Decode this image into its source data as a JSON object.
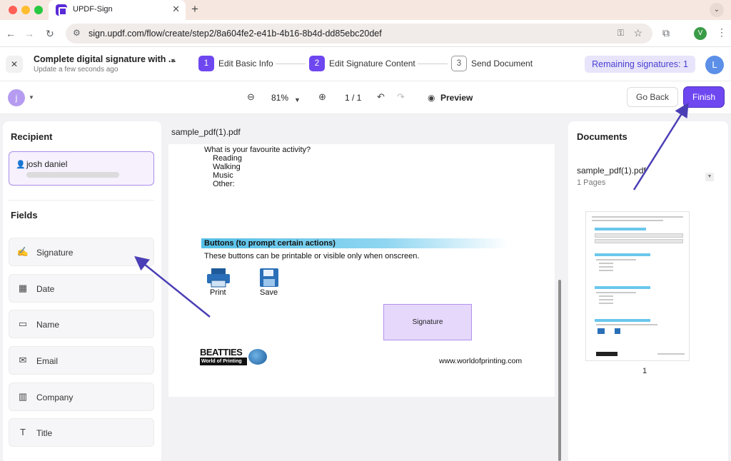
{
  "browser": {
    "tab_title": "UPDF-Sign",
    "tab_close": "✕",
    "new_tab": "+",
    "url": "sign.updf.com/flow/create/step2/8a604fe2-e41b-4b16-8b4d-dd85ebc20def",
    "profile_initial": "V"
  },
  "header": {
    "title": "Complete digital signature with ...",
    "subtitle": "Update a few seconds ago",
    "steps": [
      {
        "num": "1",
        "label": "Edit Basic Info"
      },
      {
        "num": "2",
        "label": "Edit Signature Content"
      },
      {
        "num": "3",
        "label": "Send Document"
      }
    ],
    "remaining": "Remaining signatures: 1",
    "avatar": "L"
  },
  "toolbar": {
    "user_initial": "j",
    "zoom": "81%",
    "page": "1 / 1",
    "preview": "Preview",
    "go_back": "Go Back",
    "finish": "Finish"
  },
  "left": {
    "recipient_heading": "Recipient",
    "recipient_name": "josh daniel",
    "recipient_email": "",
    "fields_heading": "Fields",
    "fields": [
      {
        "label": "Signature",
        "icon": "signature-icon"
      },
      {
        "label": "Date",
        "icon": "calendar-icon"
      },
      {
        "label": "Name",
        "icon": "id-card-icon"
      },
      {
        "label": "Email",
        "icon": "envelope-icon"
      },
      {
        "label": "Company",
        "icon": "building-icon"
      },
      {
        "label": "Title",
        "icon": "title-icon"
      }
    ]
  },
  "pdf": {
    "filename": "sample_pdf(1).pdf",
    "question": "What is your favourite activity?",
    "options": [
      "Reading",
      "Walking",
      "Music",
      "Other:"
    ],
    "section_title": "Buttons (to prompt certain actions)",
    "section_desc": "These buttons can be printable or visible only when onscreen.",
    "print_label": "Print",
    "save_label": "Save",
    "signature_field": "Signature",
    "logo_word": "BEATTIES",
    "logo_sub": "World of Printing",
    "website": "www.worldofprinting.com"
  },
  "right": {
    "heading": "Documents",
    "doc_name": "sample_pdf(1).pdf",
    "pages": "1 Pages",
    "thumb_page": "1"
  },
  "colors": {
    "accent": "#6f47f0",
    "annotation_arrow": "#4b3fb5",
    "signature_fill": "#e5d8fb"
  }
}
